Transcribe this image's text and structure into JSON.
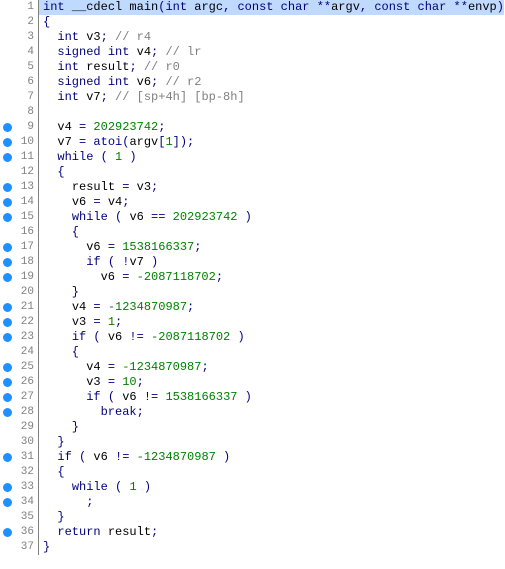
{
  "lines": [
    {
      "n": 1,
      "bp": false,
      "hl": true,
      "segs": [
        [
          "ty",
          "int "
        ],
        [
          "id",
          "__cdecl main"
        ],
        [
          "punc",
          "("
        ],
        [
          "ty",
          "int "
        ],
        [
          "id",
          "argc"
        ],
        [
          "punc",
          ", "
        ],
        [
          "ty",
          "const char "
        ],
        [
          "punc",
          "**"
        ],
        [
          "id",
          "argv"
        ],
        [
          "punc",
          ", "
        ],
        [
          "ty",
          "const char "
        ],
        [
          "punc",
          "**"
        ],
        [
          "id",
          "envp"
        ],
        [
          "punc",
          ")"
        ]
      ]
    },
    {
      "n": 2,
      "bp": false,
      "segs": [
        [
          "punc",
          "{"
        ]
      ]
    },
    {
      "n": 3,
      "bp": false,
      "segs": [
        [
          "punc",
          "  "
        ],
        [
          "ty",
          "int "
        ],
        [
          "id",
          "v3"
        ],
        [
          "punc",
          "; "
        ],
        [
          "cmt",
          "// r4"
        ]
      ]
    },
    {
      "n": 4,
      "bp": false,
      "segs": [
        [
          "punc",
          "  "
        ],
        [
          "ty",
          "signed int "
        ],
        [
          "id",
          "v4"
        ],
        [
          "punc",
          "; "
        ],
        [
          "cmt",
          "// lr"
        ]
      ]
    },
    {
      "n": 5,
      "bp": false,
      "segs": [
        [
          "punc",
          "  "
        ],
        [
          "ty",
          "int "
        ],
        [
          "id",
          "result"
        ],
        [
          "punc",
          "; "
        ],
        [
          "cmt",
          "// r0"
        ]
      ]
    },
    {
      "n": 6,
      "bp": false,
      "segs": [
        [
          "punc",
          "  "
        ],
        [
          "ty",
          "signed int "
        ],
        [
          "id",
          "v6"
        ],
        [
          "punc",
          "; "
        ],
        [
          "cmt",
          "// r2"
        ]
      ]
    },
    {
      "n": 7,
      "bp": false,
      "segs": [
        [
          "punc",
          "  "
        ],
        [
          "ty",
          "int "
        ],
        [
          "id",
          "v7"
        ],
        [
          "punc",
          "; "
        ],
        [
          "cmt",
          "// [sp+4h] [bp-8h]"
        ]
      ]
    },
    {
      "n": 8,
      "bp": false,
      "segs": []
    },
    {
      "n": 9,
      "bp": true,
      "segs": [
        [
          "punc",
          "  "
        ],
        [
          "id",
          "v4"
        ],
        [
          "punc",
          " = "
        ],
        [
          "num",
          "202923742"
        ],
        [
          "punc",
          ";"
        ]
      ]
    },
    {
      "n": 10,
      "bp": true,
      "segs": [
        [
          "punc",
          "  "
        ],
        [
          "id",
          "v7"
        ],
        [
          "punc",
          " = "
        ],
        [
          "fn",
          "atoi"
        ],
        [
          "punc",
          "("
        ],
        [
          "id",
          "argv"
        ],
        [
          "punc",
          "["
        ],
        [
          "num",
          "1"
        ],
        [
          "punc",
          "]);"
        ]
      ]
    },
    {
      "n": 11,
      "bp": true,
      "segs": [
        [
          "punc",
          "  "
        ],
        [
          "kw",
          "while"
        ],
        [
          "punc",
          " ( "
        ],
        [
          "num",
          "1"
        ],
        [
          "punc",
          " )"
        ]
      ]
    },
    {
      "n": 12,
      "bp": false,
      "segs": [
        [
          "punc",
          "  {"
        ]
      ]
    },
    {
      "n": 13,
      "bp": true,
      "segs": [
        [
          "punc",
          "    "
        ],
        [
          "id",
          "result"
        ],
        [
          "punc",
          " = "
        ],
        [
          "id",
          "v3"
        ],
        [
          "punc",
          ";"
        ]
      ]
    },
    {
      "n": 14,
      "bp": true,
      "segs": [
        [
          "punc",
          "    "
        ],
        [
          "id",
          "v6"
        ],
        [
          "punc",
          " = "
        ],
        [
          "id",
          "v4"
        ],
        [
          "punc",
          ";"
        ]
      ]
    },
    {
      "n": 15,
      "bp": true,
      "segs": [
        [
          "punc",
          "    "
        ],
        [
          "kw",
          "while"
        ],
        [
          "punc",
          " ( "
        ],
        [
          "id",
          "v6"
        ],
        [
          "punc",
          " == "
        ],
        [
          "num",
          "202923742"
        ],
        [
          "punc",
          " )"
        ]
      ]
    },
    {
      "n": 16,
      "bp": false,
      "segs": [
        [
          "punc",
          "    {"
        ]
      ]
    },
    {
      "n": 17,
      "bp": true,
      "segs": [
        [
          "punc",
          "      "
        ],
        [
          "id",
          "v6"
        ],
        [
          "punc",
          " = "
        ],
        [
          "num",
          "1538166337"
        ],
        [
          "punc",
          ";"
        ]
      ]
    },
    {
      "n": 18,
      "bp": true,
      "segs": [
        [
          "punc",
          "      "
        ],
        [
          "kw",
          "if"
        ],
        [
          "punc",
          " ( !"
        ],
        [
          "id",
          "v7"
        ],
        [
          "punc",
          " )"
        ]
      ]
    },
    {
      "n": 19,
      "bp": true,
      "segs": [
        [
          "punc",
          "        "
        ],
        [
          "id",
          "v6"
        ],
        [
          "punc",
          " = "
        ],
        [
          "num",
          "-2087118702"
        ],
        [
          "punc",
          ";"
        ]
      ]
    },
    {
      "n": 20,
      "bp": false,
      "segs": [
        [
          "punc",
          "    }"
        ]
      ]
    },
    {
      "n": 21,
      "bp": true,
      "segs": [
        [
          "punc",
          "    "
        ],
        [
          "id",
          "v4"
        ],
        [
          "punc",
          " = "
        ],
        [
          "num",
          "-1234870987"
        ],
        [
          "punc",
          ";"
        ]
      ]
    },
    {
      "n": 22,
      "bp": true,
      "segs": [
        [
          "punc",
          "    "
        ],
        [
          "id",
          "v3"
        ],
        [
          "punc",
          " = "
        ],
        [
          "num",
          "1"
        ],
        [
          "punc",
          ";"
        ]
      ]
    },
    {
      "n": 23,
      "bp": true,
      "segs": [
        [
          "punc",
          "    "
        ],
        [
          "kw",
          "if"
        ],
        [
          "punc",
          " ( "
        ],
        [
          "id",
          "v6"
        ],
        [
          "punc",
          " != "
        ],
        [
          "num",
          "-2087118702"
        ],
        [
          "punc",
          " )"
        ]
      ]
    },
    {
      "n": 24,
      "bp": false,
      "segs": [
        [
          "punc",
          "    {"
        ]
      ]
    },
    {
      "n": 25,
      "bp": true,
      "segs": [
        [
          "punc",
          "      "
        ],
        [
          "id",
          "v4"
        ],
        [
          "punc",
          " = "
        ],
        [
          "num",
          "-1234870987"
        ],
        [
          "punc",
          ";"
        ]
      ]
    },
    {
      "n": 26,
      "bp": true,
      "segs": [
        [
          "punc",
          "      "
        ],
        [
          "id",
          "v3"
        ],
        [
          "punc",
          " = "
        ],
        [
          "num",
          "10"
        ],
        [
          "punc",
          ";"
        ]
      ]
    },
    {
      "n": 27,
      "bp": true,
      "segs": [
        [
          "punc",
          "      "
        ],
        [
          "kw",
          "if"
        ],
        [
          "punc",
          " ( "
        ],
        [
          "id",
          "v6"
        ],
        [
          "punc",
          " != "
        ],
        [
          "num",
          "1538166337"
        ],
        [
          "punc",
          " )"
        ]
      ]
    },
    {
      "n": 28,
      "bp": true,
      "segs": [
        [
          "punc",
          "        "
        ],
        [
          "kw",
          "break"
        ],
        [
          "punc",
          ";"
        ]
      ]
    },
    {
      "n": 29,
      "bp": false,
      "segs": [
        [
          "punc",
          "    }"
        ]
      ]
    },
    {
      "n": 30,
      "bp": false,
      "segs": [
        [
          "punc",
          "  }"
        ]
      ]
    },
    {
      "n": 31,
      "bp": true,
      "segs": [
        [
          "punc",
          "  "
        ],
        [
          "kw",
          "if"
        ],
        [
          "punc",
          " ( "
        ],
        [
          "id",
          "v6"
        ],
        [
          "punc",
          " != "
        ],
        [
          "num",
          "-1234870987"
        ],
        [
          "punc",
          " )"
        ]
      ]
    },
    {
      "n": 32,
      "bp": false,
      "segs": [
        [
          "punc",
          "  {"
        ]
      ]
    },
    {
      "n": 33,
      "bp": true,
      "segs": [
        [
          "punc",
          "    "
        ],
        [
          "kw",
          "while"
        ],
        [
          "punc",
          " ( "
        ],
        [
          "num",
          "1"
        ],
        [
          "punc",
          " )"
        ]
      ]
    },
    {
      "n": 34,
      "bp": true,
      "segs": [
        [
          "punc",
          "      ;"
        ]
      ]
    },
    {
      "n": 35,
      "bp": false,
      "segs": [
        [
          "punc",
          "  }"
        ]
      ]
    },
    {
      "n": 36,
      "bp": true,
      "segs": [
        [
          "punc",
          "  "
        ],
        [
          "kw",
          "return"
        ],
        [
          "punc",
          " "
        ],
        [
          "id",
          "result"
        ],
        [
          "punc",
          ";"
        ]
      ]
    },
    {
      "n": 37,
      "bp": false,
      "segs": [
        [
          "punc",
          "}"
        ]
      ]
    }
  ]
}
